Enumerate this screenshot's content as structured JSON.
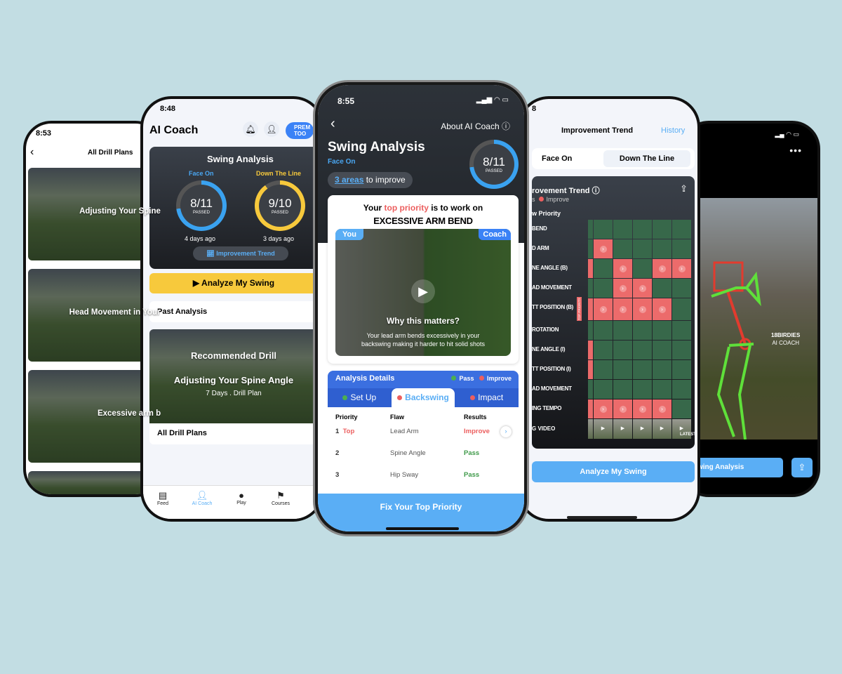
{
  "colors": {
    "background": "#c2dde3",
    "accent_blue": "#3b82f6",
    "light_blue": "#5aaef5",
    "yellow": "#f7c93c",
    "pass_green": "#3f9a4a",
    "improve_red": "#ec5f5f",
    "cell_green": "#37684a",
    "cell_red": "#ec6b6b"
  },
  "drill_plans": {
    "time": "8:53",
    "title": "All Drill Plans",
    "back_icon": "chevron-left-icon",
    "items": [
      "Adjusting Your Spine A",
      "Head Movement in Your B",
      "Excessive arm ber",
      ""
    ]
  },
  "ai_coach": {
    "time": "8:48",
    "title": "AI Coach",
    "premium_label": "PREM TOO",
    "card": {
      "title": "Swing Analysis",
      "face_on": {
        "label": "Face On",
        "score": "8/11",
        "passed": "PASSED",
        "ago": "4 days ago",
        "fraction": 0.727
      },
      "down_the_line": {
        "label": "Down The Line",
        "score": "9/10",
        "passed": "PASSED",
        "ago": "3 days ago",
        "fraction": 0.9
      },
      "trend_button": "Improvement Trend"
    },
    "analyze_button": "Analyze My Swing",
    "past_analysis": "Past Analysis",
    "recommended": {
      "heading": "Recommended Drill",
      "title": "Adjusting Your Spine Angle",
      "meta": "7 Days  .  Drill Plan"
    },
    "all_drill_plans": "All Drill Plans",
    "tabs": [
      {
        "label": "Feed",
        "icon": "feed-icon"
      },
      {
        "label": "AI Coach",
        "icon": "coach-icon",
        "active": true
      },
      {
        "label": "Play",
        "icon": "golf-ball-icon"
      },
      {
        "label": "Courses",
        "icon": "flag-icon"
      }
    ]
  },
  "swing_analysis": {
    "time": "8:55",
    "about": "About AI Coach",
    "title": "Swing Analysis",
    "view": "Face On",
    "areas_link": "3 areas",
    "areas_rest": " to improve",
    "score": "8/11",
    "passed": "PASSED",
    "fraction": 0.727,
    "priority": {
      "pre": "Your ",
      "highlight": "top priority",
      "post": " is to work on",
      "flaw": "EXCESSIVE ARM BEND"
    },
    "video": {
      "you": "You",
      "coach": "Coach",
      "why": "Why this matters?",
      "desc": "Your lead arm bends excessively in your backswing making it harder to hit solid shots"
    },
    "details": {
      "title": "Analysis Details",
      "legend_pass": "Pass",
      "legend_improve": "Improve",
      "tabs": [
        {
          "label": "Set Up",
          "status": "pass"
        },
        {
          "label": "Backswing",
          "status": "improve",
          "active": true
        },
        {
          "label": "Impact",
          "status": "improve"
        }
      ],
      "headers": [
        "Priority",
        "Flaw",
        "Results"
      ],
      "rows": [
        {
          "num": "1",
          "tag": "Top",
          "flaw": "Lead Arm",
          "result": "Improve",
          "status": "improve"
        },
        {
          "num": "2",
          "tag": "",
          "flaw": "Spine Angle",
          "result": "Pass",
          "status": "pass"
        },
        {
          "num": "3",
          "tag": "",
          "flaw": "Hip Sway",
          "result": "Pass",
          "status": "pass"
        }
      ]
    },
    "cta": "Fix Your Top Priority"
  },
  "trend": {
    "time": "8",
    "title": "Improvement Trend",
    "history": "History",
    "seg": [
      "Face On",
      "Down The Line"
    ],
    "card_title": "rovement Trend",
    "legend_pass": "s",
    "legend_improve": "Improve",
    "col_header": "w Priority",
    "top_priority_tag": "TOP PRIORITY",
    "rows": [
      {
        "label": "BEND",
        "cells": [
          0,
          0,
          0,
          0,
          0,
          0
        ]
      },
      {
        "label": "D ARM",
        "cells": [
          0,
          1,
          0,
          0,
          0,
          0
        ]
      },
      {
        "label": "NE ANGLE (B)",
        "cells": [
          1,
          0,
          1,
          0,
          1,
          1
        ]
      },
      {
        "label": "AD MOVEMENT",
        "cells": [
          0,
          0,
          1,
          1,
          0,
          0
        ]
      },
      {
        "label": "TT POSITION (B)",
        "cells": [
          1,
          1,
          1,
          1,
          1,
          0
        ],
        "top": true
      },
      {
        "label": "ROTATION",
        "cells": [
          0,
          0,
          0,
          0,
          0,
          0
        ]
      },
      {
        "label": "NE ANGLE (I)",
        "cells": [
          1,
          0,
          0,
          0,
          0,
          0
        ]
      },
      {
        "label": "TT POSITION (I)",
        "cells": [
          1,
          0,
          0,
          0,
          0,
          0
        ]
      },
      {
        "label": "AD MOVEMENT",
        "cells": [
          0,
          0,
          0,
          0,
          0,
          0
        ]
      },
      {
        "label": "ING TEMPO",
        "cells": [
          1,
          1,
          1,
          1,
          1,
          0
        ]
      }
    ],
    "video_row": "G VIDEO",
    "latest": "LATEST",
    "analyze_button": "Analyze My Swing"
  },
  "pose": {
    "menu_icon": "more-icon",
    "brand": "18BIRDIES",
    "brand_sub": "AI COACH",
    "button": "wing Analysis",
    "share_icon": "share-icon"
  }
}
